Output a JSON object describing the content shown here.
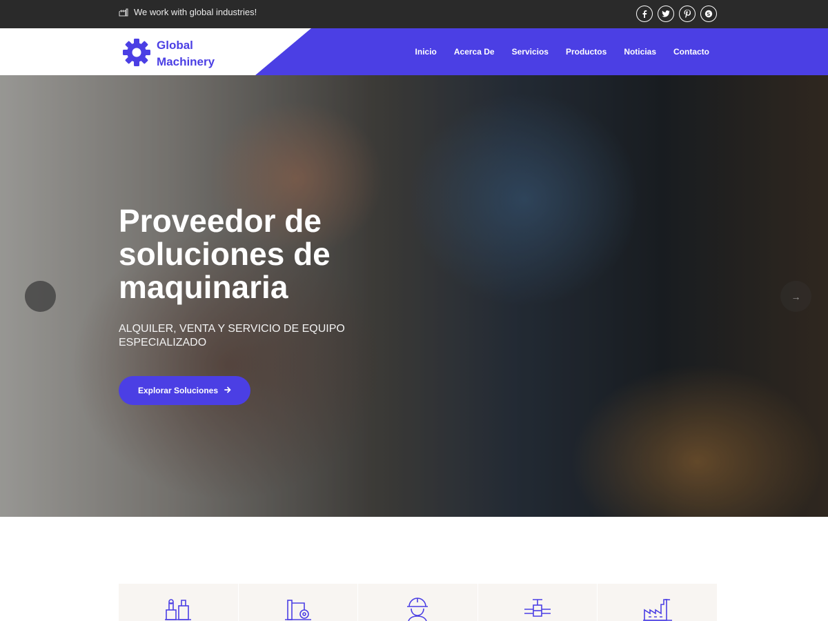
{
  "topbar": {
    "tagline": "We work with global industries!",
    "tagline_icon": "industry-icon",
    "socials": [
      "facebook-icon",
      "twitter-icon",
      "pinterest-icon",
      "skype-icon"
    ]
  },
  "header": {
    "logo_line1": "Global",
    "logo_line2": "Machinery",
    "logo_icon": "gear-icon",
    "nav": [
      "Inicio",
      "Acerca De",
      "Servicios",
      "Productos",
      "Noticias",
      "Contacto"
    ]
  },
  "hero": {
    "title": "Proveedor de soluciones de maquinaria",
    "subtitle": "ALQUILER, VENTA Y SERVICIO DE EQUIPO ESPECIALIZADO",
    "button_label": "Explorar Soluciones",
    "button_icon": "arrow-right-icon"
  },
  "services": {
    "icons": [
      "machinery-icon",
      "robot-arm-icon",
      "worker-helmet-icon",
      "valve-pipe-icon",
      "factory-icon"
    ]
  },
  "colors": {
    "accent": "#4b3fe4",
    "topbar_bg": "#2a2a2a",
    "service_bg": "#f8f5f2"
  }
}
